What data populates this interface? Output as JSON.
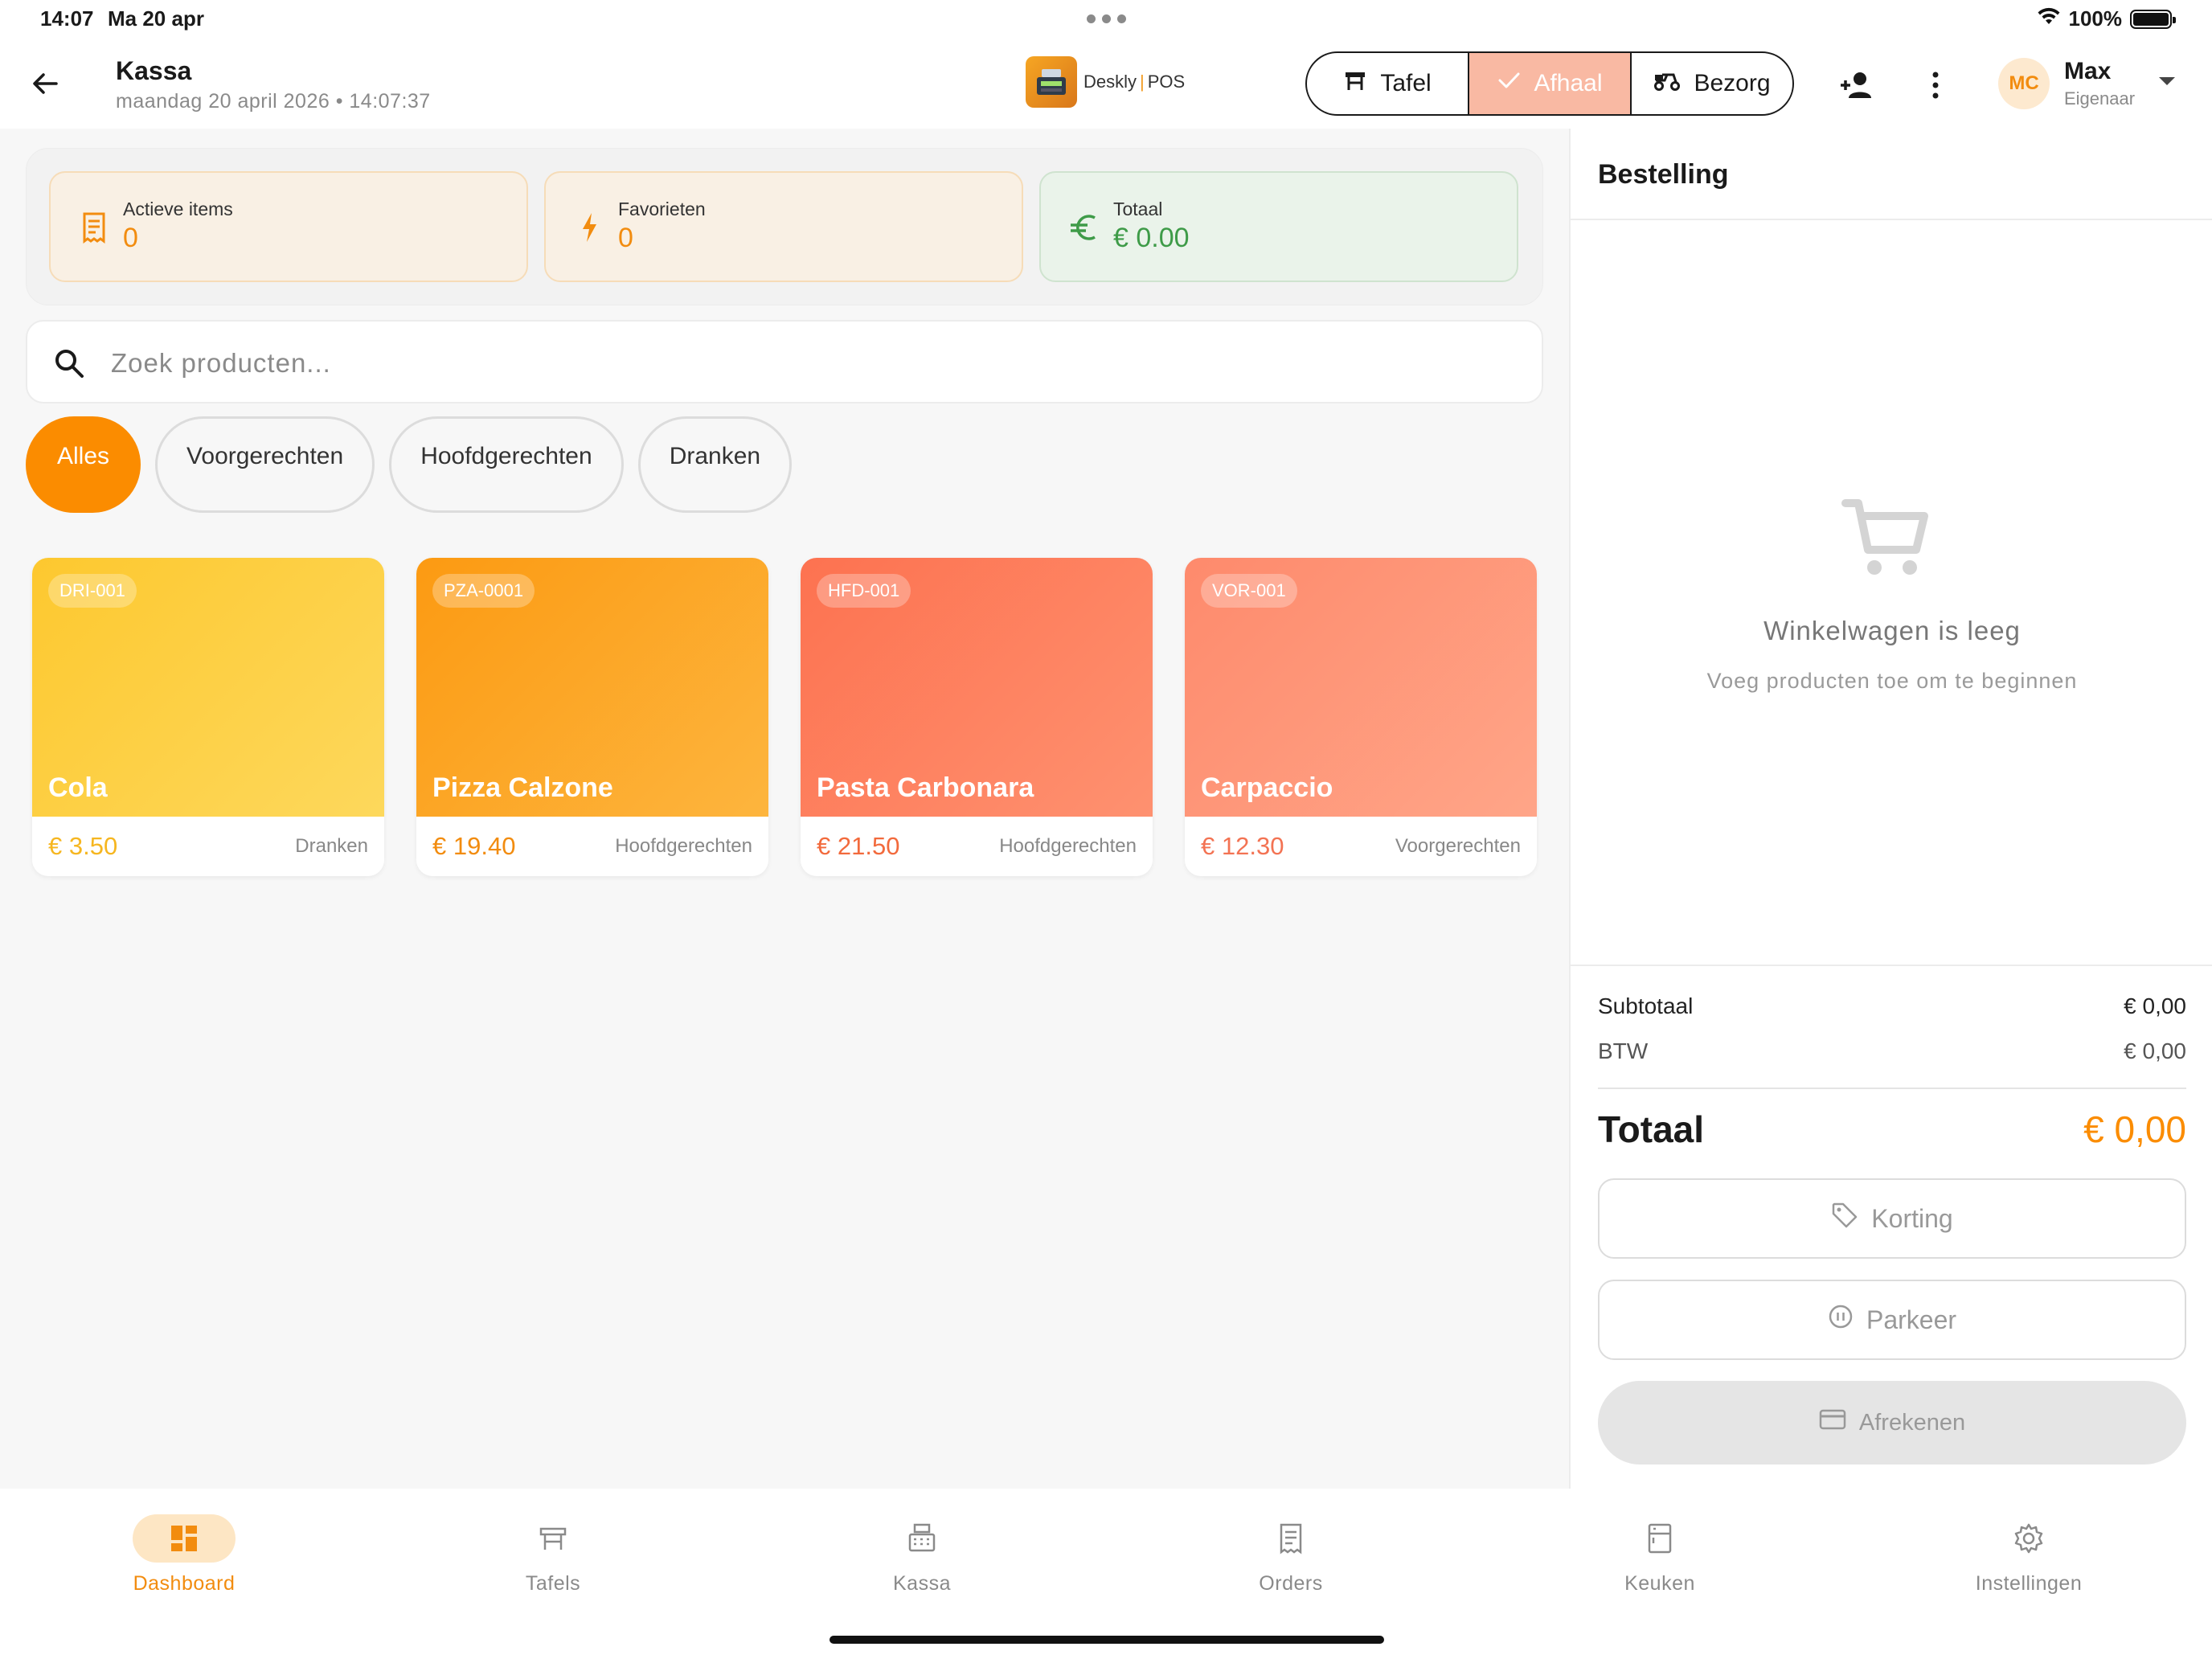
{
  "status_bar": {
    "time": "14:07",
    "date": "Ma 20 apr",
    "battery": "100%"
  },
  "header": {
    "title": "Kassa",
    "subtitle": "maandag 20 april 2026 • 14:07:37",
    "logo_brand": "Deskly",
    "logo_product": "POS",
    "modes": [
      {
        "label": "Tafel",
        "icon": "table-icon",
        "active": false
      },
      {
        "label": "Afhaal",
        "icon": "check-icon",
        "active": true
      },
      {
        "label": "Bezorg",
        "icon": "scooter-icon",
        "active": false
      }
    ],
    "user": {
      "initials": "MC",
      "name": "Max",
      "role": "Eigenaar"
    }
  },
  "stats": [
    {
      "label": "Actieve items",
      "value": "0",
      "icon": "receipt-icon"
    },
    {
      "label": "Favorieten",
      "value": "0",
      "icon": "bolt-icon"
    },
    {
      "label": "Totaal",
      "value": "€ 0.00",
      "icon": "euro-icon"
    }
  ],
  "search": {
    "placeholder": "Zoek producten..."
  },
  "categories": [
    {
      "label": "Alles",
      "active": true
    },
    {
      "label": "Voorgerechten",
      "active": false
    },
    {
      "label": "Hoofdgerechten",
      "active": false
    },
    {
      "label": "Dranken",
      "active": false
    }
  ],
  "products": [
    {
      "code": "DRI-001",
      "name": "Cola",
      "price": "€ 3.50",
      "category": "Dranken",
      "color": "#fdd03a",
      "price_color": "#f6b620"
    },
    {
      "code": "PZA-0001",
      "name": "Pizza Calzone",
      "price": "€ 19.40",
      "category": "Hoofdgerechten",
      "color": "#fca21c",
      "price_color": "#f28c0f"
    },
    {
      "code": "HFD-001",
      "name": "Pasta Carbonara",
      "price": "€ 21.50",
      "category": "Hoofdgerechten",
      "color": "#fd7f5a",
      "price_color": "#f26a3c"
    },
    {
      "code": "VOR-001",
      "name": "Carpaccio",
      "price": "€ 12.30",
      "category": "Voorgerechten",
      "color": "#fe9478",
      "price_color": "#f37353"
    }
  ],
  "order": {
    "title": "Bestelling",
    "empty_title": "Winkelwagen is leeg",
    "empty_subtitle": "Voeg producten toe om te beginnen",
    "subtotal_label": "Subtotaal",
    "subtotal_value": "€ 0,00",
    "btw_label": "BTW",
    "btw_value": "€ 0,00",
    "total_label": "Totaal",
    "total_value": "€ 0,00",
    "discount_label": "Korting",
    "park_label": "Parkeer",
    "checkout_label": "Afrekenen"
  },
  "nav": [
    {
      "label": "Dashboard",
      "icon": "dashboard-icon",
      "active": true
    },
    {
      "label": "Tafels",
      "icon": "table-icon",
      "active": false
    },
    {
      "label": "Kassa",
      "icon": "cash-register-icon",
      "active": false
    },
    {
      "label": "Orders",
      "icon": "receipt-icon",
      "active": false
    },
    {
      "label": "Keuken",
      "icon": "kitchen-icon",
      "active": false
    },
    {
      "label": "Instellingen",
      "icon": "gear-icon",
      "active": false
    }
  ]
}
